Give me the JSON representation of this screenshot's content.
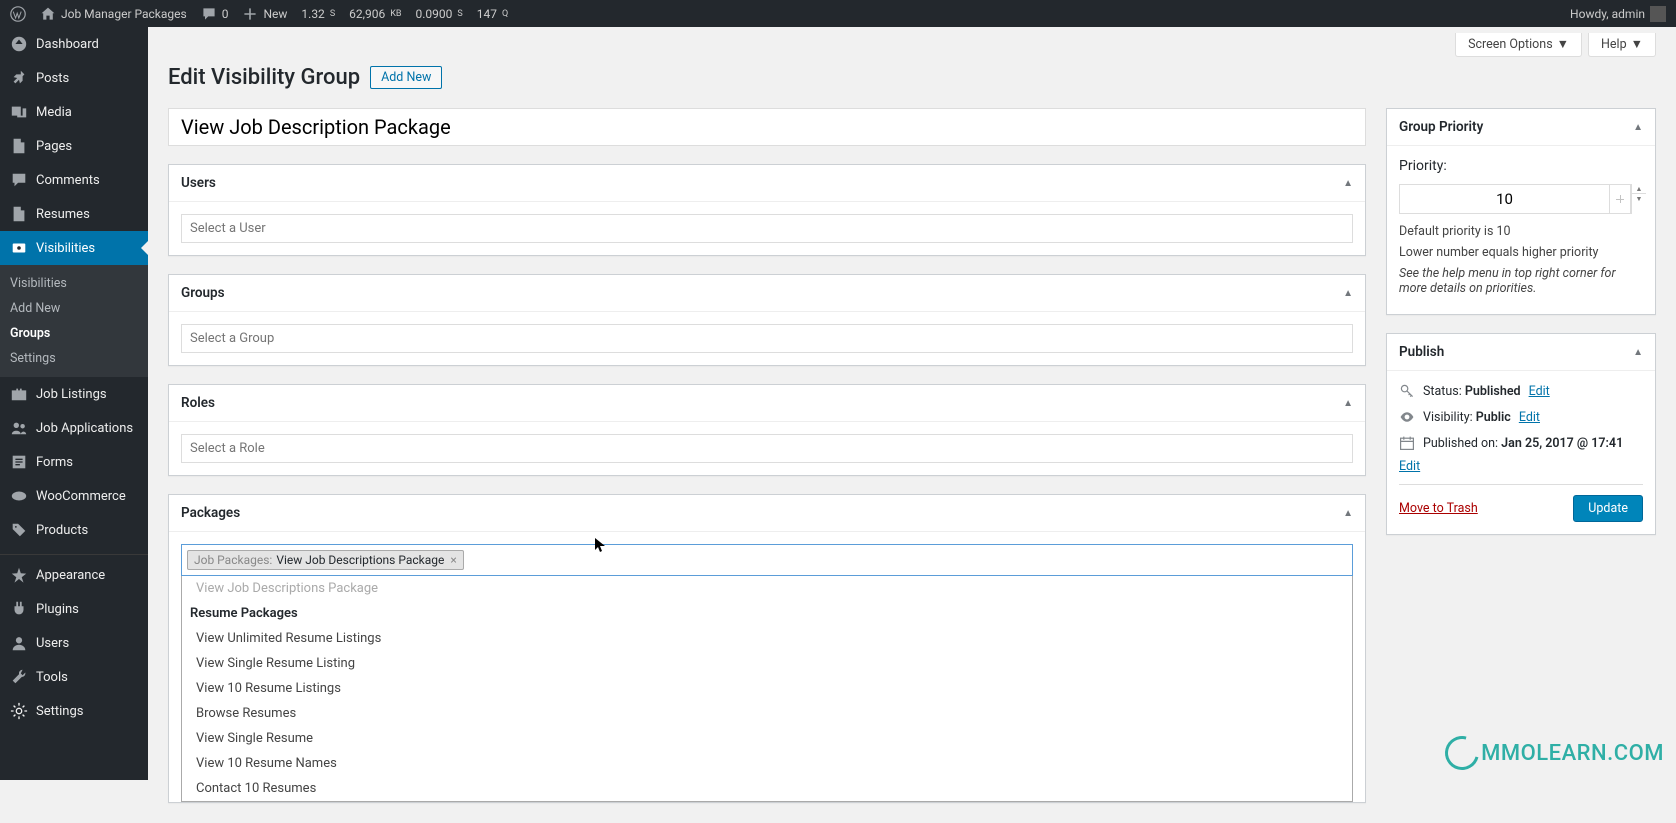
{
  "adminbar": {
    "site_name": "Job Manager Packages",
    "comments": "0",
    "new": "New",
    "stat1": "1.32",
    "stat1_unit": "S",
    "stat2": "62,906",
    "stat2_unit": "KB",
    "stat3": "0.0900",
    "stat3_unit": "S",
    "stat4": "147",
    "stat4_unit": "Q",
    "howdy": "Howdy, admin"
  },
  "sidebar": {
    "items": [
      {
        "label": "Dashboard",
        "icon": "dashboard"
      },
      {
        "label": "Posts",
        "icon": "pin"
      },
      {
        "label": "Media",
        "icon": "media"
      },
      {
        "label": "Pages",
        "icon": "page"
      },
      {
        "label": "Comments",
        "icon": "comment"
      },
      {
        "label": "Resumes",
        "icon": "page"
      },
      {
        "label": "Visibilities",
        "icon": "visibility",
        "current": true,
        "submenu": [
          {
            "label": "Visibilities"
          },
          {
            "label": "Add New"
          },
          {
            "label": "Groups",
            "current": true
          },
          {
            "label": "Settings"
          }
        ]
      },
      {
        "label": "Job Listings",
        "icon": "briefcase"
      },
      {
        "label": "Job Applications",
        "icon": "users"
      },
      {
        "label": "Forms",
        "icon": "form"
      },
      {
        "label": "WooCommerce",
        "icon": "woo"
      },
      {
        "label": "Products",
        "icon": "product"
      },
      {
        "separator": true
      },
      {
        "label": "Appearance",
        "icon": "appearance"
      },
      {
        "label": "Plugins",
        "icon": "plugin"
      },
      {
        "label": "Users",
        "icon": "user"
      },
      {
        "label": "Tools",
        "icon": "tools"
      },
      {
        "label": "Settings",
        "icon": "settings"
      }
    ]
  },
  "screen_tabs": {
    "options": "Screen Options",
    "help": "Help"
  },
  "header": {
    "title": "Edit Visibility Group",
    "add_new": "Add New"
  },
  "title_field": {
    "value": "View Job Description Package"
  },
  "boxes": {
    "users": {
      "title": "Users",
      "placeholder": "Select a User"
    },
    "groups": {
      "title": "Groups",
      "placeholder": "Select a Group"
    },
    "roles": {
      "title": "Roles",
      "placeholder": "Select a Role"
    },
    "packages": {
      "title": "Packages",
      "chip_prefix": "Job Packages:",
      "chip_label": "View Job Descriptions Package",
      "dropdown": {
        "disabled_item": "View Job Descriptions Package",
        "group": "Resume Packages",
        "items": [
          "View Unlimited Resume Listings",
          "View Single Resume Listing",
          "View 10 Resume Listings",
          "Browse Resumes",
          "View Single Resume",
          "View 10 Resume Names",
          "Contact 10 Resumes"
        ]
      }
    }
  },
  "priority": {
    "box_title": "Group Priority",
    "label": "Priority:",
    "value": "10",
    "help1": "Default priority is 10",
    "help2": "Lower number equals higher priority",
    "help3": "See the help menu in top right corner for more details on priorities."
  },
  "publish": {
    "box_title": "Publish",
    "status_label": "Status:",
    "status_value": "Published",
    "visibility_label": "Visibility:",
    "visibility_value": "Public",
    "published_label": "Published on:",
    "published_value": "Jan 25, 2017 @ 17:41",
    "edit": "Edit",
    "trash": "Move to Trash",
    "update": "Update"
  },
  "watermark": "MMOLEARN.COM"
}
